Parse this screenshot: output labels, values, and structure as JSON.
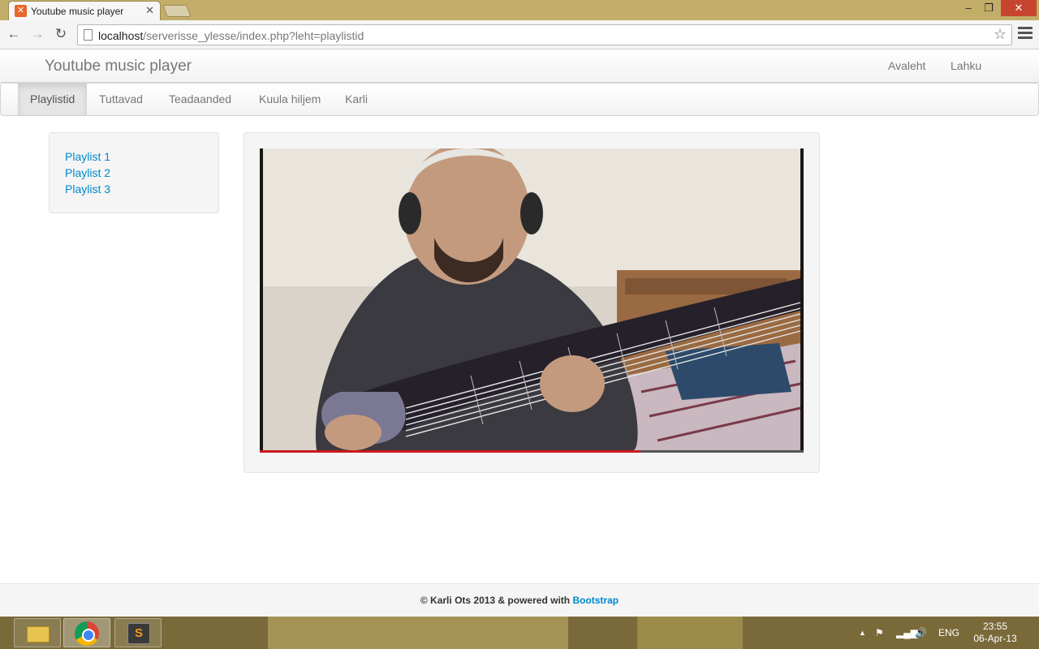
{
  "browser": {
    "tab_title": "Youtube music player",
    "tab_close": "✕",
    "url_host": "localhost",
    "url_path": "/serverisse_ylesse/index.php?leht=playlistid",
    "window_controls": {
      "minimize": "–",
      "maximize": "❐",
      "close": "✕"
    },
    "nav": {
      "back": "←",
      "forward": "→",
      "reload": "↻",
      "star": "☆"
    }
  },
  "header": {
    "brand": "Youtube music player",
    "links": [
      "Avaleht",
      "Lahku"
    ]
  },
  "subnav": {
    "items": [
      "Playlistid",
      "Tuttavad",
      "Teadaanded",
      "Kuula hiljem",
      "Karli"
    ],
    "active": "Playlistid"
  },
  "sidebar": {
    "playlists": [
      "Playlist 1",
      "Playlist 2",
      "Playlist 3"
    ]
  },
  "video": {
    "progress_fraction": 0.7
  },
  "footer": {
    "text": "© Karli Ots 2013 & powered with ",
    "link": "Bootstrap"
  },
  "taskbar": {
    "apps": [
      "file-explorer-icon",
      "chrome-icon",
      "sublime-text-icon"
    ],
    "sublime_glyph": "S",
    "tray": {
      "up": "▲",
      "flag": "⚑",
      "signal": "▂▄▆",
      "volume": "🔊"
    },
    "language": "ENG",
    "time": "23:55",
    "date": "06-Apr-13"
  },
  "colors": {
    "link": "#0088cc",
    "titlebar": "#c2ad69",
    "close_button": "#c7452f",
    "progress": "#cc181e"
  }
}
